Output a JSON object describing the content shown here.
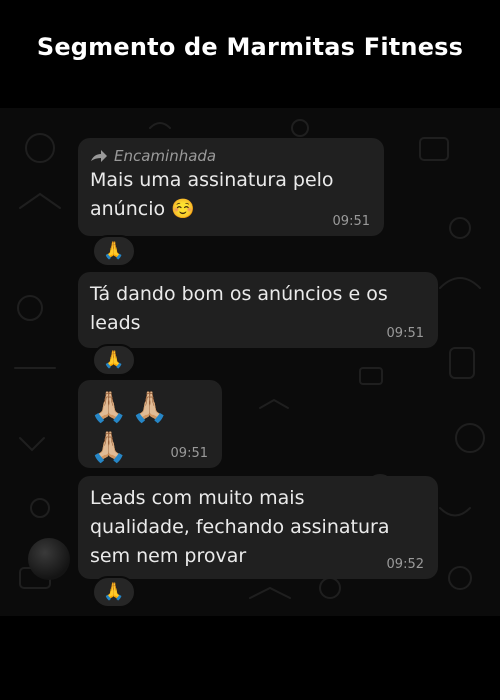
{
  "header": {
    "title": "Segmento de Marmitas Fitness"
  },
  "messages": [
    {
      "forwarded_label": "Encaminhada",
      "text": "Mais uma assinatura pelo\nanúncio ☺️",
      "time": "09:51",
      "reaction": "🙏"
    },
    {
      "text": "Tá dando bom os anúncios e os\nleads",
      "time": "09:51",
      "reaction": "🙏"
    },
    {
      "text": "🙏🏼🙏🏼🙏🏼",
      "time": "09:51"
    },
    {
      "text": "Leads com muito mais\nqualidade, fechando assinatura\nsem nem provar",
      "time": "09:52",
      "reaction": "🙏"
    }
  ],
  "colors": {
    "bubble": "#202020",
    "background": "#0b0b0b",
    "text": "#eaeaea",
    "meta": "#9a9a9a"
  }
}
